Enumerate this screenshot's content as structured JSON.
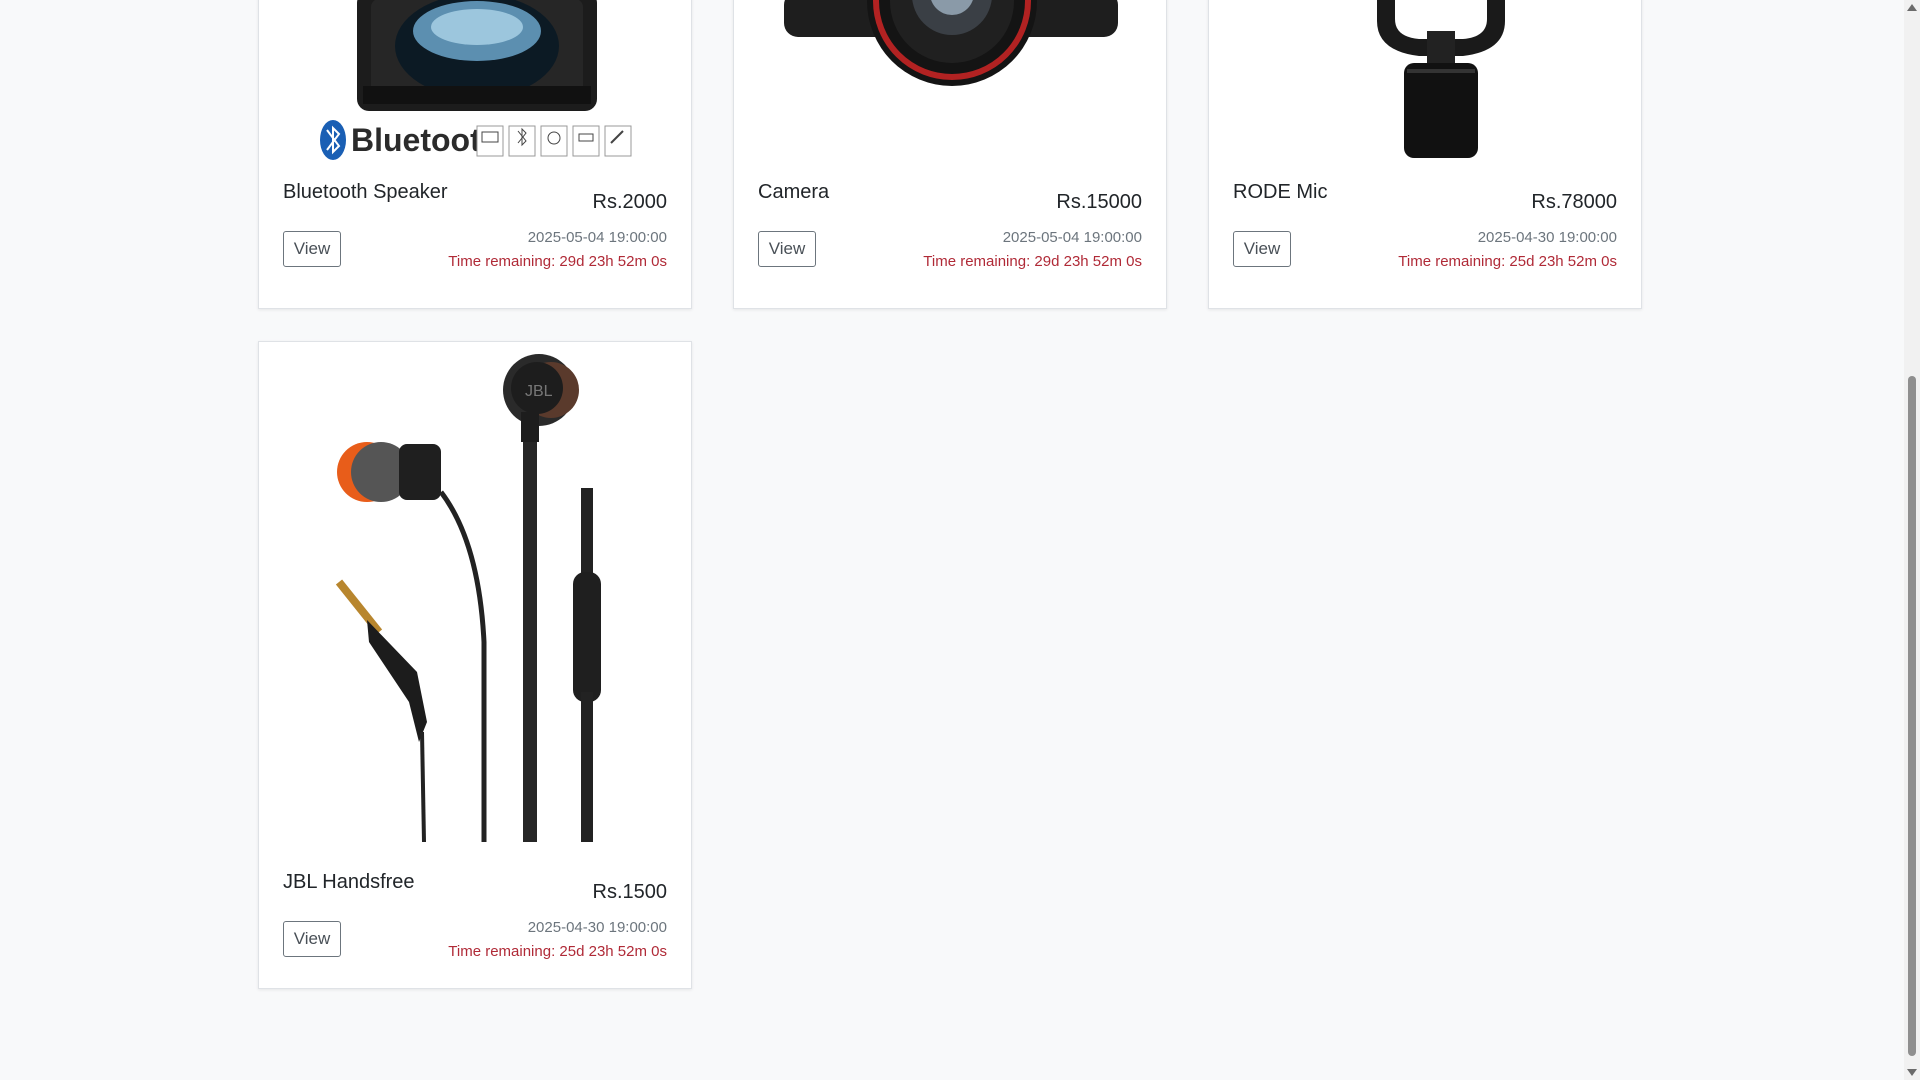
{
  "products": [
    {
      "name": "Bluetooth Speaker",
      "price": "Rs.2000",
      "view_label": "View",
      "date": "2025-05-04 19:00:00",
      "time_remaining": "Time remaining: 29d 23h 52m 0s",
      "image_icon": "speaker-image",
      "image_text": "Bluetooth",
      "feature_icons": [
        "FM radio",
        "Bluetooth",
        "Voice",
        "USB/TF",
        "Microphone"
      ]
    },
    {
      "name": "Camera",
      "price": "Rs.15000",
      "view_label": "View",
      "date": "2025-05-04 19:00:00",
      "time_remaining": "Time remaining: 29d 23h 52m 0s",
      "image_icon": "camera-image"
    },
    {
      "name": "RODE Mic",
      "price": "Rs.78000",
      "view_label": "View",
      "date": "2025-04-30 19:00:00",
      "time_remaining": "Time remaining: 25d 23h 52m 0s",
      "image_icon": "microphone-image"
    },
    {
      "name": "JBL Handsfree",
      "price": "Rs.1500",
      "view_label": "View",
      "date": "2025-04-30 19:00:00",
      "time_remaining": "Time remaining: 25d 23h 52m 0s",
      "image_icon": "earphones-image",
      "image_text": "JBL"
    }
  ],
  "colors": {
    "background": "#f8f9fa",
    "countdown": "#b02a37",
    "muted": "#6c757d"
  }
}
